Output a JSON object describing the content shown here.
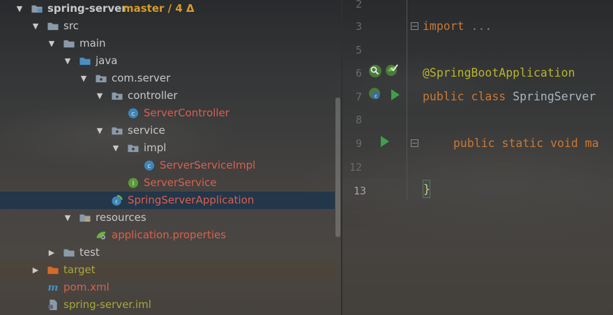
{
  "tree": {
    "items": [
      {
        "label": "spring-server",
        "vcs": "master / 4 Δ",
        "icon": "module-folder-icon",
        "depth": 0,
        "expanded": true,
        "color": "default",
        "bold": true
      },
      {
        "label": "src",
        "icon": "folder-icon",
        "depth": 1,
        "expanded": true,
        "color": "default"
      },
      {
        "label": "main",
        "icon": "folder-icon",
        "depth": 2,
        "expanded": true,
        "color": "default"
      },
      {
        "label": "java",
        "icon": "source-folder-icon",
        "depth": 3,
        "expanded": true,
        "color": "default"
      },
      {
        "label": "com.server",
        "icon": "package-icon",
        "depth": 4,
        "expanded": true,
        "color": "default"
      },
      {
        "label": "controller",
        "icon": "package-icon",
        "depth": 5,
        "expanded": true,
        "color": "default"
      },
      {
        "label": "ServerController",
        "icon": "java-class-icon",
        "depth": 6,
        "expanded": null,
        "color": "red"
      },
      {
        "label": "service",
        "icon": "package-icon",
        "depth": 5,
        "expanded": true,
        "color": "default"
      },
      {
        "label": "impl",
        "icon": "package-icon",
        "depth": 6,
        "expanded": true,
        "color": "default"
      },
      {
        "label": "ServerServiceImpl",
        "icon": "java-class-icon",
        "depth": 7,
        "expanded": null,
        "color": "red"
      },
      {
        "label": "ServerService",
        "icon": "java-interface-icon",
        "depth": 6,
        "expanded": null,
        "color": "red"
      },
      {
        "label": "SpringServerApplication",
        "icon": "spring-boot-class-icon",
        "depth": 5,
        "expanded": null,
        "color": "red",
        "selected": true
      },
      {
        "label": "resources",
        "icon": "resources-folder-icon",
        "depth": 3,
        "expanded": true,
        "color": "default"
      },
      {
        "label": "application.properties",
        "icon": "spring-properties-icon",
        "depth": 4,
        "expanded": null,
        "color": "red"
      },
      {
        "label": "test",
        "icon": "folder-icon",
        "depth": 2,
        "expanded": false,
        "color": "default"
      },
      {
        "label": "target",
        "icon": "excluded-folder-icon",
        "depth": 1,
        "expanded": false,
        "color": "olive",
        "excluded": true
      },
      {
        "label": "pom.xml",
        "icon": "maven-icon",
        "depth": 1,
        "expanded": null,
        "color": "red"
      },
      {
        "label": "spring-server.iml",
        "icon": "iml-file-icon",
        "depth": 1,
        "expanded": null,
        "color": "olive"
      }
    ]
  },
  "editor": {
    "line_numbers": [
      "2",
      "3",
      "5",
      "6",
      "7",
      "8",
      "9",
      "12",
      "13"
    ],
    "current_line": "13",
    "code": {
      "line3_kw": "import",
      "line3_rest": " ...",
      "line6_ann": "@SpringBootApplication",
      "line7_kw1": "public",
      "line7_kw2": "class",
      "line7_cls": "SpringServer",
      "line9_kw1": "public",
      "line9_kw2": "static",
      "line9_kw3": "void",
      "line9_rest": "ma",
      "line13": "}"
    },
    "gutter_icons": [
      "find-usages-icon",
      "spring-bean-icon",
      "spring-boot-icon",
      "run-icon",
      "run-icon"
    ]
  },
  "colors": {
    "accent_selection": "#16324e",
    "vcs_branch": "#d79b28",
    "modified_file": "#d9604f",
    "keyword": "#cc7832",
    "annotation": "#bbb529"
  }
}
